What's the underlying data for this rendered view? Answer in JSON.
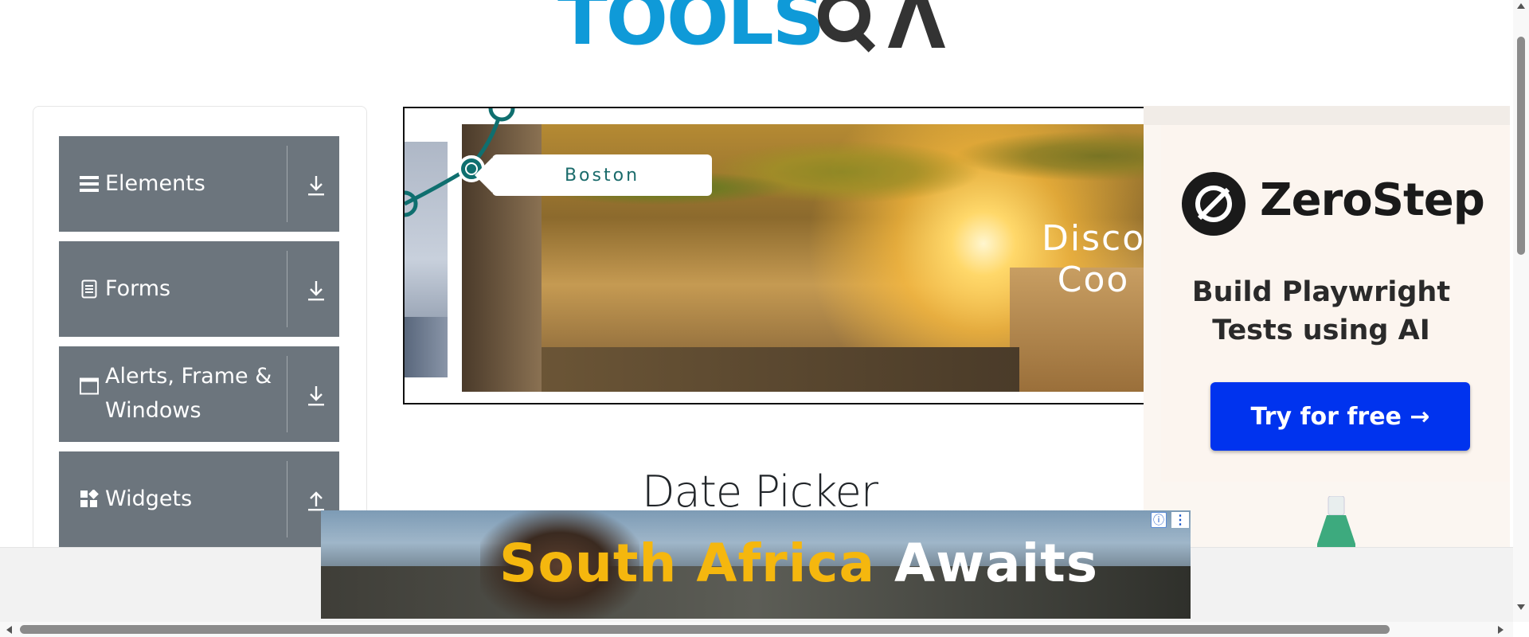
{
  "logo": {
    "word_tools": "TOOLS",
    "word_qa": "QA"
  },
  "sidebar": {
    "groups": [
      {
        "label": "Elements",
        "icon": "hamburger-icon",
        "arrow": "download-icon"
      },
      {
        "label": "Forms",
        "icon": "document-icon",
        "arrow": "download-icon"
      },
      {
        "label": "Alerts, Frame & Windows",
        "label_line1": "Alerts, Frame &",
        "label_line2": "Windows",
        "icon": "window-icon",
        "arrow": "download-icon"
      },
      {
        "label": "Widgets",
        "icon": "widgets-icon",
        "arrow": "upload-icon"
      }
    ]
  },
  "banner": {
    "tag": "Boston",
    "overlay_line1": "Disco",
    "overlay_line2": "Coo"
  },
  "ad_right": {
    "brand": "ZeroStep",
    "tagline_line1": "Build Playwright",
    "tagline_line2": "Tests using AI",
    "cta": "Try for free →"
  },
  "main": {
    "title": "Date Picker"
  },
  "ad_bottom": {
    "headline_yellow": "South Africa",
    "headline_white": "Awaits",
    "info_glyph": "ⓘ",
    "more_glyph": "⋮"
  },
  "colors": {
    "sidebar_group_bg": "#6c757d",
    "logo_blue": "#0f9ad8",
    "cta_blue": "#0033ee",
    "headline_yellow": "#f5b70e"
  }
}
